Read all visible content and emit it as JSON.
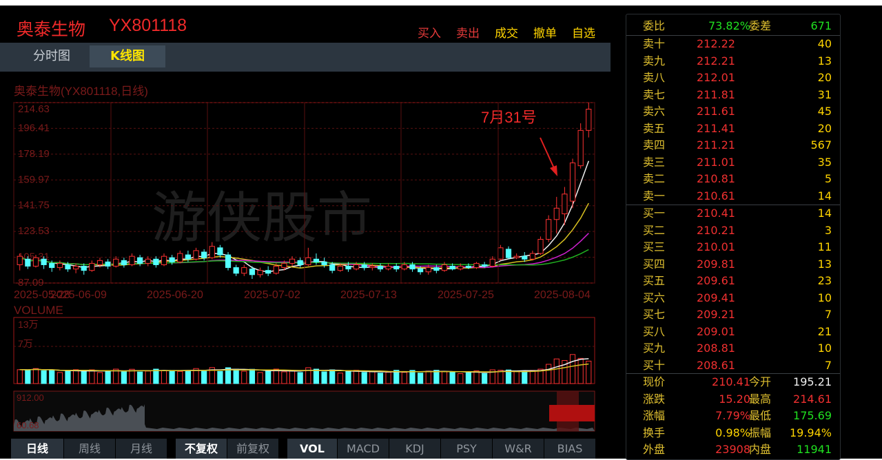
{
  "header": {
    "stock_name": "奥泰生物",
    "stock_code": "YX801118",
    "actions": [
      {
        "label": "买入",
        "color": "#e53a3a"
      },
      {
        "label": "卖出",
        "color": "#e53a3a"
      },
      {
        "label": "成交",
        "color": "#ffd400"
      },
      {
        "label": "撤单",
        "color": "#ffd400"
      },
      {
        "label": "自选",
        "color": "#ffd400"
      }
    ]
  },
  "tabs": [
    {
      "label": "分时图"
    },
    {
      "label": "K线图"
    }
  ],
  "kline": {
    "title": "奥泰生物(YX801118,日线)",
    "watermark": "游侠股市",
    "annotation": "7月31号",
    "y_ticks": [
      "214.63",
      "196.41",
      "178.19",
      "159.97",
      "141.75",
      "123.53",
      "105.31",
      "87.09"
    ],
    "x_ticks": [
      "2025-05-28",
      "2025-06-09",
      "2025-06-20",
      "2025-07-02",
      "2025-07-13",
      "2025-07-25",
      "2025-08-04"
    ]
  },
  "volume": {
    "title": "VOLUME",
    "y_ticks": [
      "13万",
      "7万"
    ]
  },
  "overview": {
    "high_label": "912.00",
    "low_label": "60.68"
  },
  "chart_data": {
    "type": "candlestick",
    "title": "奥泰生物(YX801118,日线)",
    "ylim": [
      87.09,
      214.63
    ],
    "candles": [
      [
        100,
        106,
        96,
        108
      ],
      [
        104,
        99,
        97,
        106
      ],
      [
        99,
        105,
        98,
        107
      ],
      [
        104,
        100,
        97,
        106
      ],
      [
        101,
        98,
        95,
        103
      ],
      [
        98,
        101,
        96,
        103
      ],
      [
        100,
        97,
        95,
        102
      ],
      [
        97,
        99,
        94,
        101
      ],
      [
        99,
        96,
        93,
        101
      ],
      [
        96,
        101,
        95,
        103
      ],
      [
        100,
        103,
        98,
        105
      ],
      [
        102,
        99,
        97,
        104
      ],
      [
        99,
        104,
        98,
        106
      ],
      [
        103,
        100,
        98,
        105
      ],
      [
        100,
        106,
        99,
        108
      ],
      [
        105,
        101,
        99,
        107
      ],
      [
        101,
        104,
        99,
        106
      ],
      [
        104,
        100,
        98,
        106
      ],
      [
        100,
        106,
        99,
        108
      ],
      [
        105,
        102,
        100,
        107
      ],
      [
        102,
        108,
        101,
        110
      ],
      [
        107,
        104,
        102,
        110
      ],
      [
        104,
        110,
        103,
        112
      ],
      [
        109,
        105,
        103,
        111
      ],
      [
        105,
        113,
        104,
        116
      ],
      [
        112,
        107,
        105,
        114
      ],
      [
        107,
        98,
        96,
        109
      ],
      [
        98,
        94,
        92,
        100
      ],
      [
        94,
        98,
        92,
        100
      ],
      [
        97,
        93,
        90,
        99
      ],
      [
        93,
        96,
        91,
        98
      ],
      [
        96,
        94,
        92,
        99
      ],
      [
        94,
        99,
        93,
        101
      ],
      [
        98,
        101,
        96,
        103
      ],
      [
        101,
        104,
        99,
        106
      ],
      [
        103,
        100,
        98,
        105
      ],
      [
        100,
        105,
        99,
        112
      ],
      [
        104,
        102,
        100,
        108
      ],
      [
        102,
        100,
        98,
        105
      ],
      [
        100,
        96,
        94,
        102
      ],
      [
        96,
        99,
        95,
        101
      ],
      [
        99,
        97,
        95,
        102
      ],
      [
        97,
        100,
        96,
        102
      ],
      [
        100,
        98,
        96,
        102
      ],
      [
        98,
        99,
        96,
        101
      ],
      [
        99,
        97,
        95,
        101
      ],
      [
        97,
        99,
        96,
        101
      ],
      [
        99,
        97,
        95,
        101
      ],
      [
        97,
        100,
        96,
        102
      ],
      [
        100,
        97,
        95,
        102
      ],
      [
        97,
        95,
        93,
        99
      ],
      [
        95,
        98,
        93,
        100
      ],
      [
        98,
        96,
        94,
        100
      ],
      [
        96,
        100,
        95,
        102
      ],
      [
        99,
        97,
        96,
        101
      ],
      [
        97,
        99,
        96,
        101
      ],
      [
        99,
        98,
        97,
        101
      ],
      [
        98,
        101,
        97,
        102
      ],
      [
        100,
        99,
        98,
        102
      ],
      [
        99,
        104,
        98,
        106
      ],
      [
        104,
        112,
        103,
        114
      ],
      [
        111,
        105,
        104,
        113
      ],
      [
        105,
        106,
        104,
        108
      ],
      [
        106,
        104,
        102,
        109
      ],
      [
        104,
        108,
        103,
        110
      ],
      [
        108,
        118,
        107,
        120
      ],
      [
        118,
        132,
        116,
        135
      ],
      [
        132,
        140,
        122,
        148
      ],
      [
        136,
        150,
        128,
        155
      ],
      [
        145,
        172,
        140,
        175
      ],
      [
        170,
        195,
        168,
        200
      ],
      [
        195,
        210,
        190,
        214.63
      ]
    ],
    "ma_series": [
      {
        "color": "#f0f0f0"
      },
      {
        "color": "#d8c020"
      },
      {
        "color": "#d020d0"
      },
      {
        "color": "#20b020"
      }
    ]
  },
  "toolbar": {
    "group1": [
      {
        "label": "日线",
        "active": true
      },
      {
        "label": "周线"
      },
      {
        "label": "月线"
      }
    ],
    "group2": [
      {
        "label": "不复权",
        "active": true
      },
      {
        "label": "前复权"
      }
    ],
    "group3": [
      {
        "label": "VOL",
        "active": true
      },
      {
        "label": "MACD"
      },
      {
        "label": "KDJ"
      },
      {
        "label": "PSY"
      },
      {
        "label": "W&R"
      },
      {
        "label": "BIAS"
      }
    ]
  },
  "orderbook": {
    "weibi_label": "委比",
    "weibi_value": "73.82%",
    "weicha_label": "委差",
    "weicha_value": "671",
    "asks": [
      {
        "label": "卖十",
        "price": "212.22",
        "vol": "40"
      },
      {
        "label": "卖九",
        "price": "212.21",
        "vol": "13"
      },
      {
        "label": "卖八",
        "price": "212.01",
        "vol": "20"
      },
      {
        "label": "卖七",
        "price": "211.81",
        "vol": "31"
      },
      {
        "label": "卖六",
        "price": "211.61",
        "vol": "45"
      },
      {
        "label": "卖五",
        "price": "211.41",
        "vol": "20"
      },
      {
        "label": "卖四",
        "price": "211.21",
        "vol": "567"
      },
      {
        "label": "卖三",
        "price": "211.01",
        "vol": "35"
      },
      {
        "label": "卖二",
        "price": "210.81",
        "vol": "5"
      },
      {
        "label": "卖一",
        "price": "210.61",
        "vol": "14"
      }
    ],
    "bids": [
      {
        "label": "买一",
        "price": "210.41",
        "vol": "14"
      },
      {
        "label": "买二",
        "price": "210.21",
        "vol": "3"
      },
      {
        "label": "买三",
        "price": "210.01",
        "vol": "11"
      },
      {
        "label": "买四",
        "price": "209.81",
        "vol": "13"
      },
      {
        "label": "买五",
        "price": "209.61",
        "vol": "23"
      },
      {
        "label": "买六",
        "price": "209.41",
        "vol": "10"
      },
      {
        "label": "买七",
        "price": "209.21",
        "vol": "7"
      },
      {
        "label": "买八",
        "price": "209.01",
        "vol": "21"
      },
      {
        "label": "买九",
        "price": "208.81",
        "vol": "10"
      },
      {
        "label": "买十",
        "price": "208.61",
        "vol": "7"
      }
    ],
    "stats": [
      {
        "l1": "现价",
        "v1": "210.41",
        "l2": "今开",
        "v2": "195.21",
        "c1": "#f03030",
        "c2": "#f0f0f0"
      },
      {
        "l1": "涨跌",
        "v1": "15.20",
        "l2": "最高",
        "v2": "214.61",
        "c1": "#f03030",
        "c2": "#f03030"
      },
      {
        "l1": "涨幅",
        "v1": "7.79%",
        "l2": "最低",
        "v2": "175.69",
        "c1": "#f03030",
        "c2": "#20e020"
      },
      {
        "l1": "换手",
        "v1": "0.98%",
        "l2": "振幅",
        "v2": "19.94%",
        "c1": "#ffd400",
        "c2": "#ffd400"
      },
      {
        "l1": "外盘",
        "v1": "23908",
        "l2": "内盘",
        "v2": "11941",
        "c1": "#f03030",
        "c2": "#20e020"
      }
    ]
  }
}
